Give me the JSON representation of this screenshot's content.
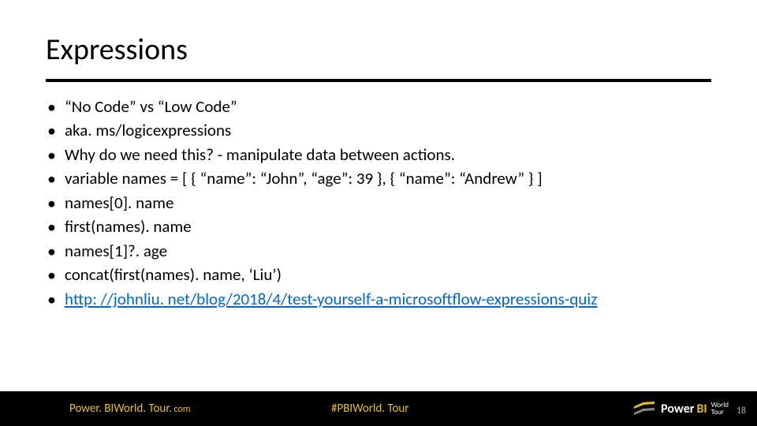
{
  "title": "Expressions",
  "bullets": [
    "“No Code” vs “Low Code”",
    "aka. ms/logicexpressions",
    "Why do we need this?  - manipulate data between actions.",
    "variable names = [ { “name”: “John”, “age”: 39 }, { “name”: “Andrew” } ]",
    "names[0]. name",
    "first(names). name",
    "names[1]?. age",
    "concat(first(names). name, ‘Liu’)"
  ],
  "link": {
    "text": "http: //johnliu. net/blog/2018/4/test-yourself-a-microsoftflow-expressions-quiz",
    "href": "http://johnliu.net/blog/2018/4/test-yourself-a-microsoftflow-expressions-quiz"
  },
  "footer": {
    "left_main": "Power. BIWorld. Tour.",
    "left_small": " com",
    "center": "#PBIWorld. Tour",
    "logo_power": "Power ",
    "logo_bi": "BI",
    "logo_sub1": "World",
    "logo_sub2": "Tour"
  },
  "page_number": "18"
}
